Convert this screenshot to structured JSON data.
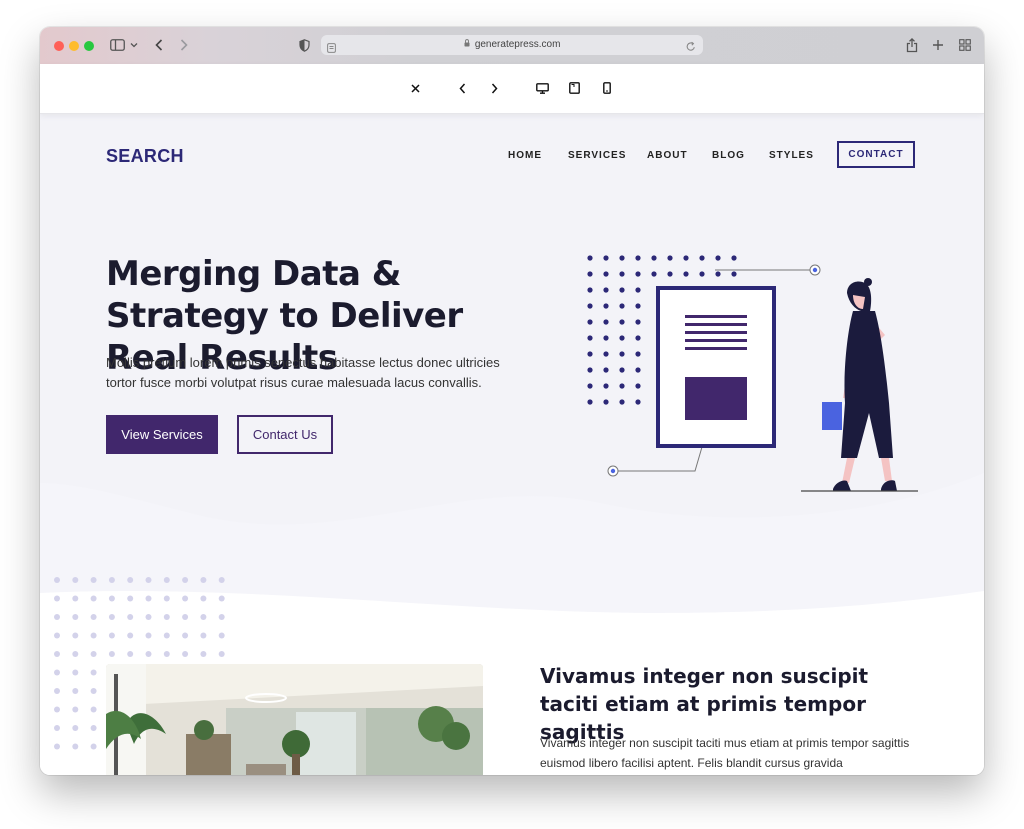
{
  "browser": {
    "url": "generatepress.com",
    "colors": {
      "close": "#ff5f57",
      "minimize": "#febc2e",
      "maximize": "#28c840"
    }
  },
  "site": {
    "logo": "SEARCH",
    "nav": {
      "items": [
        {
          "label": "HOME"
        },
        {
          "label": "SERVICES"
        },
        {
          "label": "ABOUT"
        },
        {
          "label": "BLOG"
        },
        {
          "label": "STYLES"
        }
      ],
      "contact_label": "CONTACT"
    },
    "hero": {
      "title": "Merging Data & Strategy to Deliver Real Results",
      "text": "Mollis pretium lorem primis senectus habitasse lectus donec ultricies tortor fusce morbi volutpat risus curae malesuada lacus convallis.",
      "primary_button": "View Services",
      "secondary_button": "Contact Us"
    },
    "section": {
      "title": "Vivamus integer non suscipit taciti etiam at primis tempor sagittis",
      "text": "Vivamus integer non suscipit taciti mus etiam at primis tempor sagittis euismod libero facilisi aptent. Felis blandit cursus gravida"
    },
    "colors": {
      "brand": "#2c2877",
      "button": "#41276c",
      "accent": "#4a63e0",
      "background": "#f5f5fa"
    }
  }
}
